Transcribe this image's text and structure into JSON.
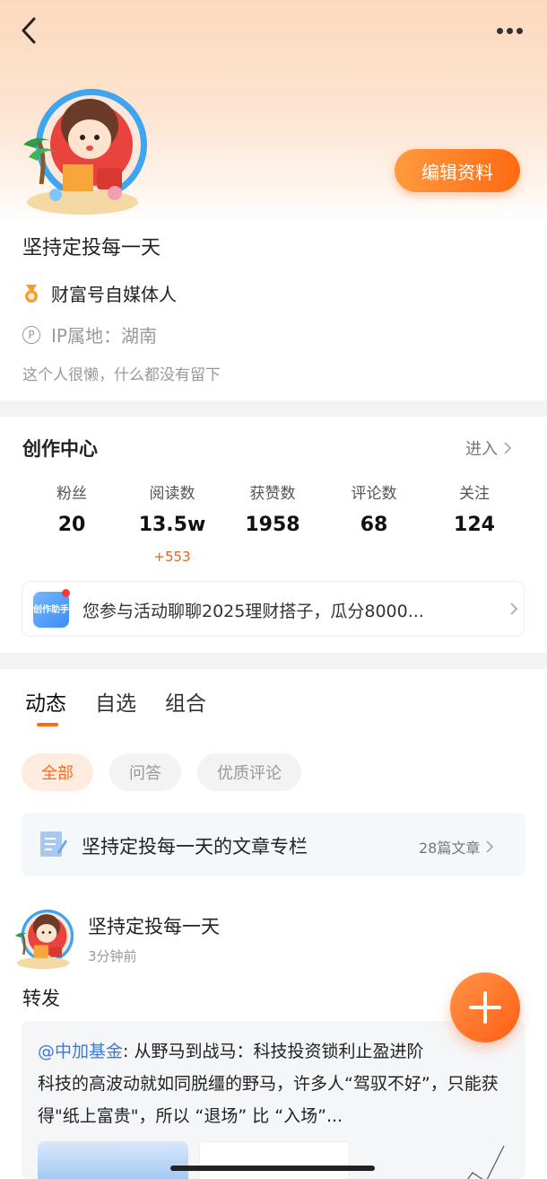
{
  "header": {
    "edit_profile_label": "编辑资料"
  },
  "profile": {
    "username": "坚持定投每一天",
    "badge_label": "财富号自媒体人",
    "ip_location": "IP属地：湖南",
    "bio": "这个人很懒，什么都没有留下"
  },
  "creator_center": {
    "title": "创作中心",
    "enter_label": "进入",
    "stats": [
      {
        "label": "粉丝",
        "value": "20"
      },
      {
        "label": "阅读数",
        "value": "13.5w",
        "delta": "+553"
      },
      {
        "label": "获赞数",
        "value": "1958"
      },
      {
        "label": "评论数",
        "value": "68"
      },
      {
        "label": "关注",
        "value": "124"
      }
    ],
    "assistant_icon_text": "创作助手",
    "assistant_message": "您参与活动聊聊2025理财搭子，瓜分8000..."
  },
  "tabs": [
    {
      "label": "动态",
      "active": true
    },
    {
      "label": "自选",
      "active": false
    },
    {
      "label": "组合",
      "active": false
    }
  ],
  "filters": [
    {
      "label": "全部",
      "active": true
    },
    {
      "label": "问答",
      "active": false
    },
    {
      "label": "优质评论",
      "active": false
    }
  ],
  "column": {
    "title": "坚持定投每一天的文章专栏",
    "count": "28篇文章"
  },
  "post": {
    "author": "坚持定投每一天",
    "time": "3分钟前",
    "action": "转发",
    "repost_mention": "@中加基金",
    "repost_title": ": 从野马到战马：科技投资锁利止盈进阶",
    "repost_body": "科技的高波动就如同脱缰的野马，许多人“驾驭不好”，只能获得\"纸上富贵\"，所以 “退场” 比 “入场”..."
  },
  "colors": {
    "accent": "#ff6a12",
    "mention": "#3b7be0"
  }
}
